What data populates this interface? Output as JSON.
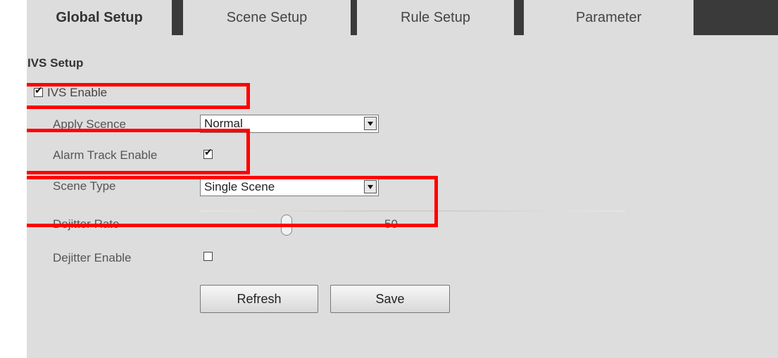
{
  "tabs": [
    {
      "label": "Global Setup",
      "active": true
    },
    {
      "label": "Scene Setup",
      "active": false
    },
    {
      "label": "Rule Setup",
      "active": false
    },
    {
      "label": "Parameter",
      "active": false
    }
  ],
  "section_title": "IVS Setup",
  "ivs_enable": {
    "label": "IVS Enable",
    "checked": true
  },
  "apply_scene": {
    "label": "Apply Scence",
    "value": "Normal"
  },
  "alarm_track": {
    "label": "Alarm Track Enable",
    "checked": true
  },
  "scene_type": {
    "label": "Scene Type",
    "value": "Single Scene"
  },
  "dejitter_rate": {
    "label": "Dejitter Rate",
    "value": "50"
  },
  "dejitter_enable": {
    "label": "Dejitter Enable",
    "checked": false
  },
  "buttons": {
    "refresh": "Refresh",
    "save": "Save"
  },
  "colors": {
    "highlight": "#ff0000",
    "panel": "#dddddd",
    "tab_bar": "#3a3a3a"
  }
}
